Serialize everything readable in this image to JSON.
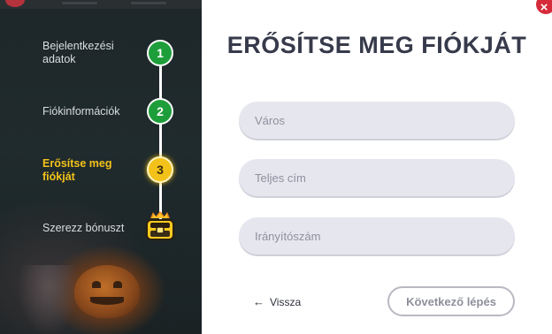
{
  "steps": [
    {
      "number": "1",
      "label": "Bejelentkezési adatok",
      "state": "done"
    },
    {
      "number": "2",
      "label": "Fiókinformációk",
      "state": "done"
    },
    {
      "number": "3",
      "label": "Erősítse meg fiókját",
      "state": "active"
    },
    {
      "label": "Szerezz bónuszt",
      "icon": "treasure-chest-icon",
      "state": "pending"
    }
  ],
  "close": {
    "symbol": "×",
    "icon": "close-icon"
  },
  "form": {
    "title": "ERŐSÍTSE MEG FIÓKJÁT",
    "city_placeholder": "Város",
    "address_placeholder": "Teljes cím",
    "zip_placeholder": "Irányítószám",
    "back_label": "Vissza",
    "back_icon": "arrow-left-icon",
    "next_label": "Következő lépés"
  },
  "colors": {
    "done": "#1e9e3a",
    "active": "#f3c21a",
    "close": "#d62b3a",
    "title": "#363a4a",
    "field_bg": "#e6e6ee"
  }
}
